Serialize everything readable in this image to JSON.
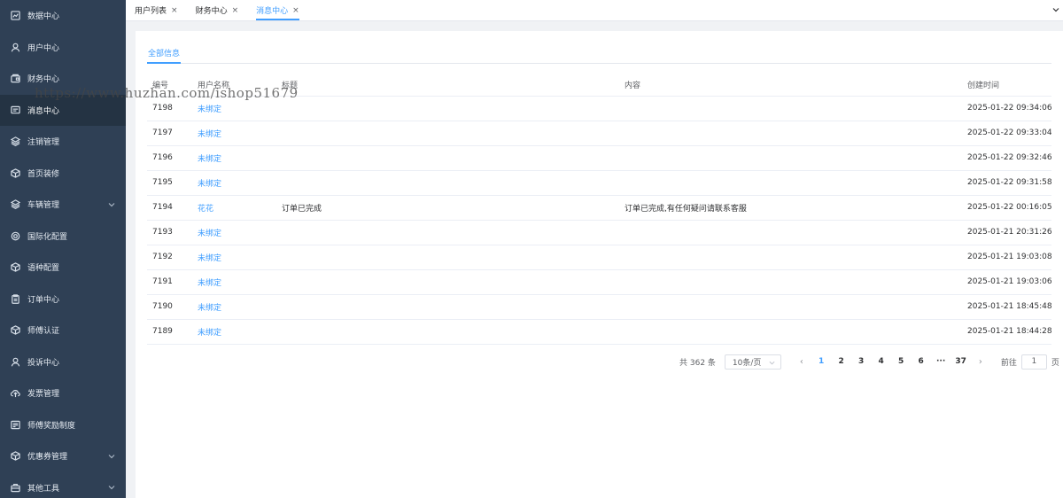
{
  "sidebar": {
    "items": [
      {
        "label": "数据中心",
        "icon": "chart-icon",
        "active": false,
        "expandable": false
      },
      {
        "label": "用户中心",
        "icon": "user-icon",
        "active": false,
        "expandable": false
      },
      {
        "label": "财务中心",
        "icon": "wallet-icon",
        "active": false,
        "expandable": false
      },
      {
        "label": "消息中心",
        "icon": "message-icon",
        "active": true,
        "expandable": false
      },
      {
        "label": "注销管理",
        "icon": "layers-icon",
        "active": false,
        "expandable": false
      },
      {
        "label": "首页装修",
        "icon": "cube-icon",
        "active": false,
        "expandable": false
      },
      {
        "label": "车辆管理",
        "icon": "layers-icon",
        "active": false,
        "expandable": true
      },
      {
        "label": "国际化配置",
        "icon": "gear-icon",
        "active": false,
        "expandable": false
      },
      {
        "label": "语种配置",
        "icon": "cube-icon",
        "active": false,
        "expandable": false
      },
      {
        "label": "订单中心",
        "icon": "clipboard-icon",
        "active": false,
        "expandable": false
      },
      {
        "label": "师傅认证",
        "icon": "cube-icon",
        "active": false,
        "expandable": false
      },
      {
        "label": "投诉中心",
        "icon": "user-icon",
        "active": false,
        "expandable": false
      },
      {
        "label": "发票管理",
        "icon": "cloud-upload-icon",
        "active": false,
        "expandable": false
      },
      {
        "label": "师傅奖励制度",
        "icon": "list-icon",
        "active": false,
        "expandable": false
      },
      {
        "label": "优惠券管理",
        "icon": "cube-icon",
        "active": false,
        "expandable": true
      },
      {
        "label": "其他工具",
        "icon": "toolbox-icon",
        "active": false,
        "expandable": true
      }
    ]
  },
  "tabs": [
    {
      "label": "用户列表",
      "close": "×",
      "active": false
    },
    {
      "label": "财务中心",
      "close": "×",
      "active": false
    },
    {
      "label": "消息中心",
      "close": "×",
      "active": true
    }
  ],
  "subtab": {
    "label": "全部信息"
  },
  "table": {
    "columns": [
      "编号",
      "用户名称",
      "标题",
      "内容",
      "创建时间"
    ],
    "rows": [
      {
        "id": "7198",
        "user": "未绑定",
        "title": "",
        "content": "",
        "created": "2025-01-22 09:34:06"
      },
      {
        "id": "7197",
        "user": "未绑定",
        "title": "",
        "content": "",
        "created": "2025-01-22 09:33:04"
      },
      {
        "id": "7196",
        "user": "未绑定",
        "title": "",
        "content": "",
        "created": "2025-01-22 09:32:46"
      },
      {
        "id": "7195",
        "user": "未绑定",
        "title": "",
        "content": "",
        "created": "2025-01-22 09:31:58"
      },
      {
        "id": "7194",
        "user": "花花",
        "title": "订单已完成",
        "content": "订单已完成,有任何疑问请联系客服",
        "created": "2025-01-22 00:16:05"
      },
      {
        "id": "7193",
        "user": "未绑定",
        "title": "",
        "content": "",
        "created": "2025-01-21 20:31:26"
      },
      {
        "id": "7192",
        "user": "未绑定",
        "title": "",
        "content": "",
        "created": "2025-01-21 19:03:08"
      },
      {
        "id": "7191",
        "user": "未绑定",
        "title": "",
        "content": "",
        "created": "2025-01-21 19:03:06"
      },
      {
        "id": "7190",
        "user": "未绑定",
        "title": "",
        "content": "",
        "created": "2025-01-21 18:45:48"
      },
      {
        "id": "7189",
        "user": "未绑定",
        "title": "",
        "content": "",
        "created": "2025-01-21 18:44:28"
      }
    ]
  },
  "pagination": {
    "total": "共 362 条",
    "page_size": "10条/页",
    "prev": "‹",
    "next": "›",
    "pages": [
      "1",
      "2",
      "3",
      "4",
      "5",
      "6",
      "···",
      "37"
    ],
    "current": "1",
    "goto_prefix": "前往",
    "goto_value": "1",
    "goto_suffix": "页"
  },
  "watermark": "https://www.huzhan.com/ishop51679",
  "colors": {
    "sidebar_bg": "#2f4055",
    "sidebar_active_bg": "#243343",
    "accent": "#409eff",
    "page_bg": "#f0f2f5"
  }
}
